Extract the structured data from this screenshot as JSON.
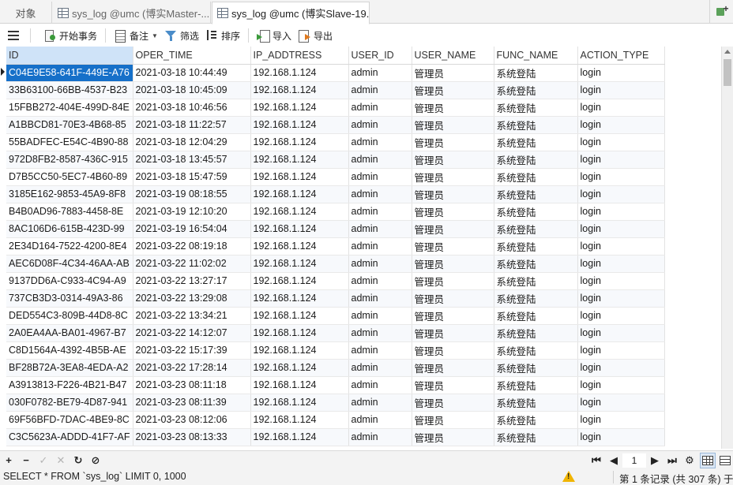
{
  "tabs": {
    "objects": "对象",
    "tab1": "sys_log @umc (博实Master-...",
    "tab2": "sys_log @umc (博实Slave-19..."
  },
  "toolbar": {
    "begin_transaction": "开始事务",
    "note": "备注",
    "filter": "筛选",
    "sort": "排序",
    "import": "导入",
    "export": "导出"
  },
  "grid": {
    "columns": [
      "ID",
      "OPER_TIME",
      "IP_ADDTRESS",
      "USER_ID",
      "USER_NAME",
      "FUNC_NAME",
      "ACTION_TYPE"
    ],
    "rows": [
      [
        "C04E9E58-641F-449E-A76",
        "2021-03-18 10:44:49",
        "192.168.1.124",
        "admin",
        "管理员",
        "系统登陆",
        "login"
      ],
      [
        "33B63100-66BB-4537-B23",
        "2021-03-18 10:45:09",
        "192.168.1.124",
        "admin",
        "管理员",
        "系统登陆",
        "login"
      ],
      [
        "15FBB272-404E-499D-84E",
        "2021-03-18 10:46:56",
        "192.168.1.124",
        "admin",
        "管理员",
        "系统登陆",
        "login"
      ],
      [
        "A1BBCD81-70E3-4B68-85",
        "2021-03-18 11:22:57",
        "192.168.1.124",
        "admin",
        "管理员",
        "系统登陆",
        "login"
      ],
      [
        "55BADFEC-E54C-4B90-88",
        "2021-03-18 12:04:29",
        "192.168.1.124",
        "admin",
        "管理员",
        "系统登陆",
        "login"
      ],
      [
        "972D8FB2-8587-436C-915",
        "2021-03-18 13:45:57",
        "192.168.1.124",
        "admin",
        "管理员",
        "系统登陆",
        "login"
      ],
      [
        "D7B5CC50-5EC7-4B60-89",
        "2021-03-18 15:47:59",
        "192.168.1.124",
        "admin",
        "管理员",
        "系统登陆",
        "login"
      ],
      [
        "3185E162-9853-45A9-8F8",
        "2021-03-19 08:18:55",
        "192.168.1.124",
        "admin",
        "管理员",
        "系统登陆",
        "login"
      ],
      [
        "B4B0AD96-7883-4458-8E",
        "2021-03-19 12:10:20",
        "192.168.1.124",
        "admin",
        "管理员",
        "系统登陆",
        "login"
      ],
      [
        "8AC106D6-615B-423D-99",
        "2021-03-19 16:54:04",
        "192.168.1.124",
        "admin",
        "管理员",
        "系统登陆",
        "login"
      ],
      [
        "2E34D164-7522-4200-8E4",
        "2021-03-22 08:19:18",
        "192.168.1.124",
        "admin",
        "管理员",
        "系统登陆",
        "login"
      ],
      [
        "AEC6D08F-4C34-46AA-AB",
        "2021-03-22 11:02:02",
        "192.168.1.124",
        "admin",
        "管理员",
        "系统登陆",
        "login"
      ],
      [
        "9137DD6A-C933-4C94-A9",
        "2021-03-22 13:27:17",
        "192.168.1.124",
        "admin",
        "管理员",
        "系统登陆",
        "login"
      ],
      [
        "737CB3D3-0314-49A3-86",
        "2021-03-22 13:29:08",
        "192.168.1.124",
        "admin",
        "管理员",
        "系统登陆",
        "login"
      ],
      [
        "DED554C3-809B-44D8-8C",
        "2021-03-22 13:34:21",
        "192.168.1.124",
        "admin",
        "管理员",
        "系统登陆",
        "login"
      ],
      [
        "2A0EA4AA-BA01-4967-B7",
        "2021-03-22 14:12:07",
        "192.168.1.124",
        "admin",
        "管理员",
        "系统登陆",
        "login"
      ],
      [
        "C8D1564A-4392-4B5B-AE",
        "2021-03-22 15:17:39",
        "192.168.1.124",
        "admin",
        "管理员",
        "系统登陆",
        "login"
      ],
      [
        "BF28B72A-3EA8-4EDA-A2",
        "2021-03-22 17:28:14",
        "192.168.1.124",
        "admin",
        "管理员",
        "系统登陆",
        "login"
      ],
      [
        "A3913813-F226-4B21-B47",
        "2021-03-23 08:11:18",
        "192.168.1.124",
        "admin",
        "管理员",
        "系统登陆",
        "login"
      ],
      [
        "030F0782-BE79-4D87-941",
        "2021-03-23 08:11:39",
        "192.168.1.124",
        "admin",
        "管理员",
        "系统登陆",
        "login"
      ],
      [
        "69F56BFD-7DAC-4BE9-8C",
        "2021-03-23 08:12:06",
        "192.168.1.124",
        "admin",
        "管理员",
        "系统登陆",
        "login"
      ],
      [
        "C3C5623A-ADDD-41F7-AF",
        "2021-03-23 08:13:33",
        "192.168.1.124",
        "admin",
        "管理员",
        "系统登陆",
        "login"
      ]
    ],
    "selected_color": "#1670c9"
  },
  "navbar": {
    "add": "+",
    "remove": "−",
    "apply": "✓",
    "discard": "✕",
    "refresh": "↻",
    "stop": "⊘",
    "first": "⏮",
    "prev": "◀",
    "page": "1",
    "next": "▶",
    "last": "⏭",
    "settings": "⚙"
  },
  "status": {
    "sql": "SELECT * FROM `sys_log` LIMIT 0, 1000",
    "record": "第 1 条记录 (共 307 条) 于"
  }
}
